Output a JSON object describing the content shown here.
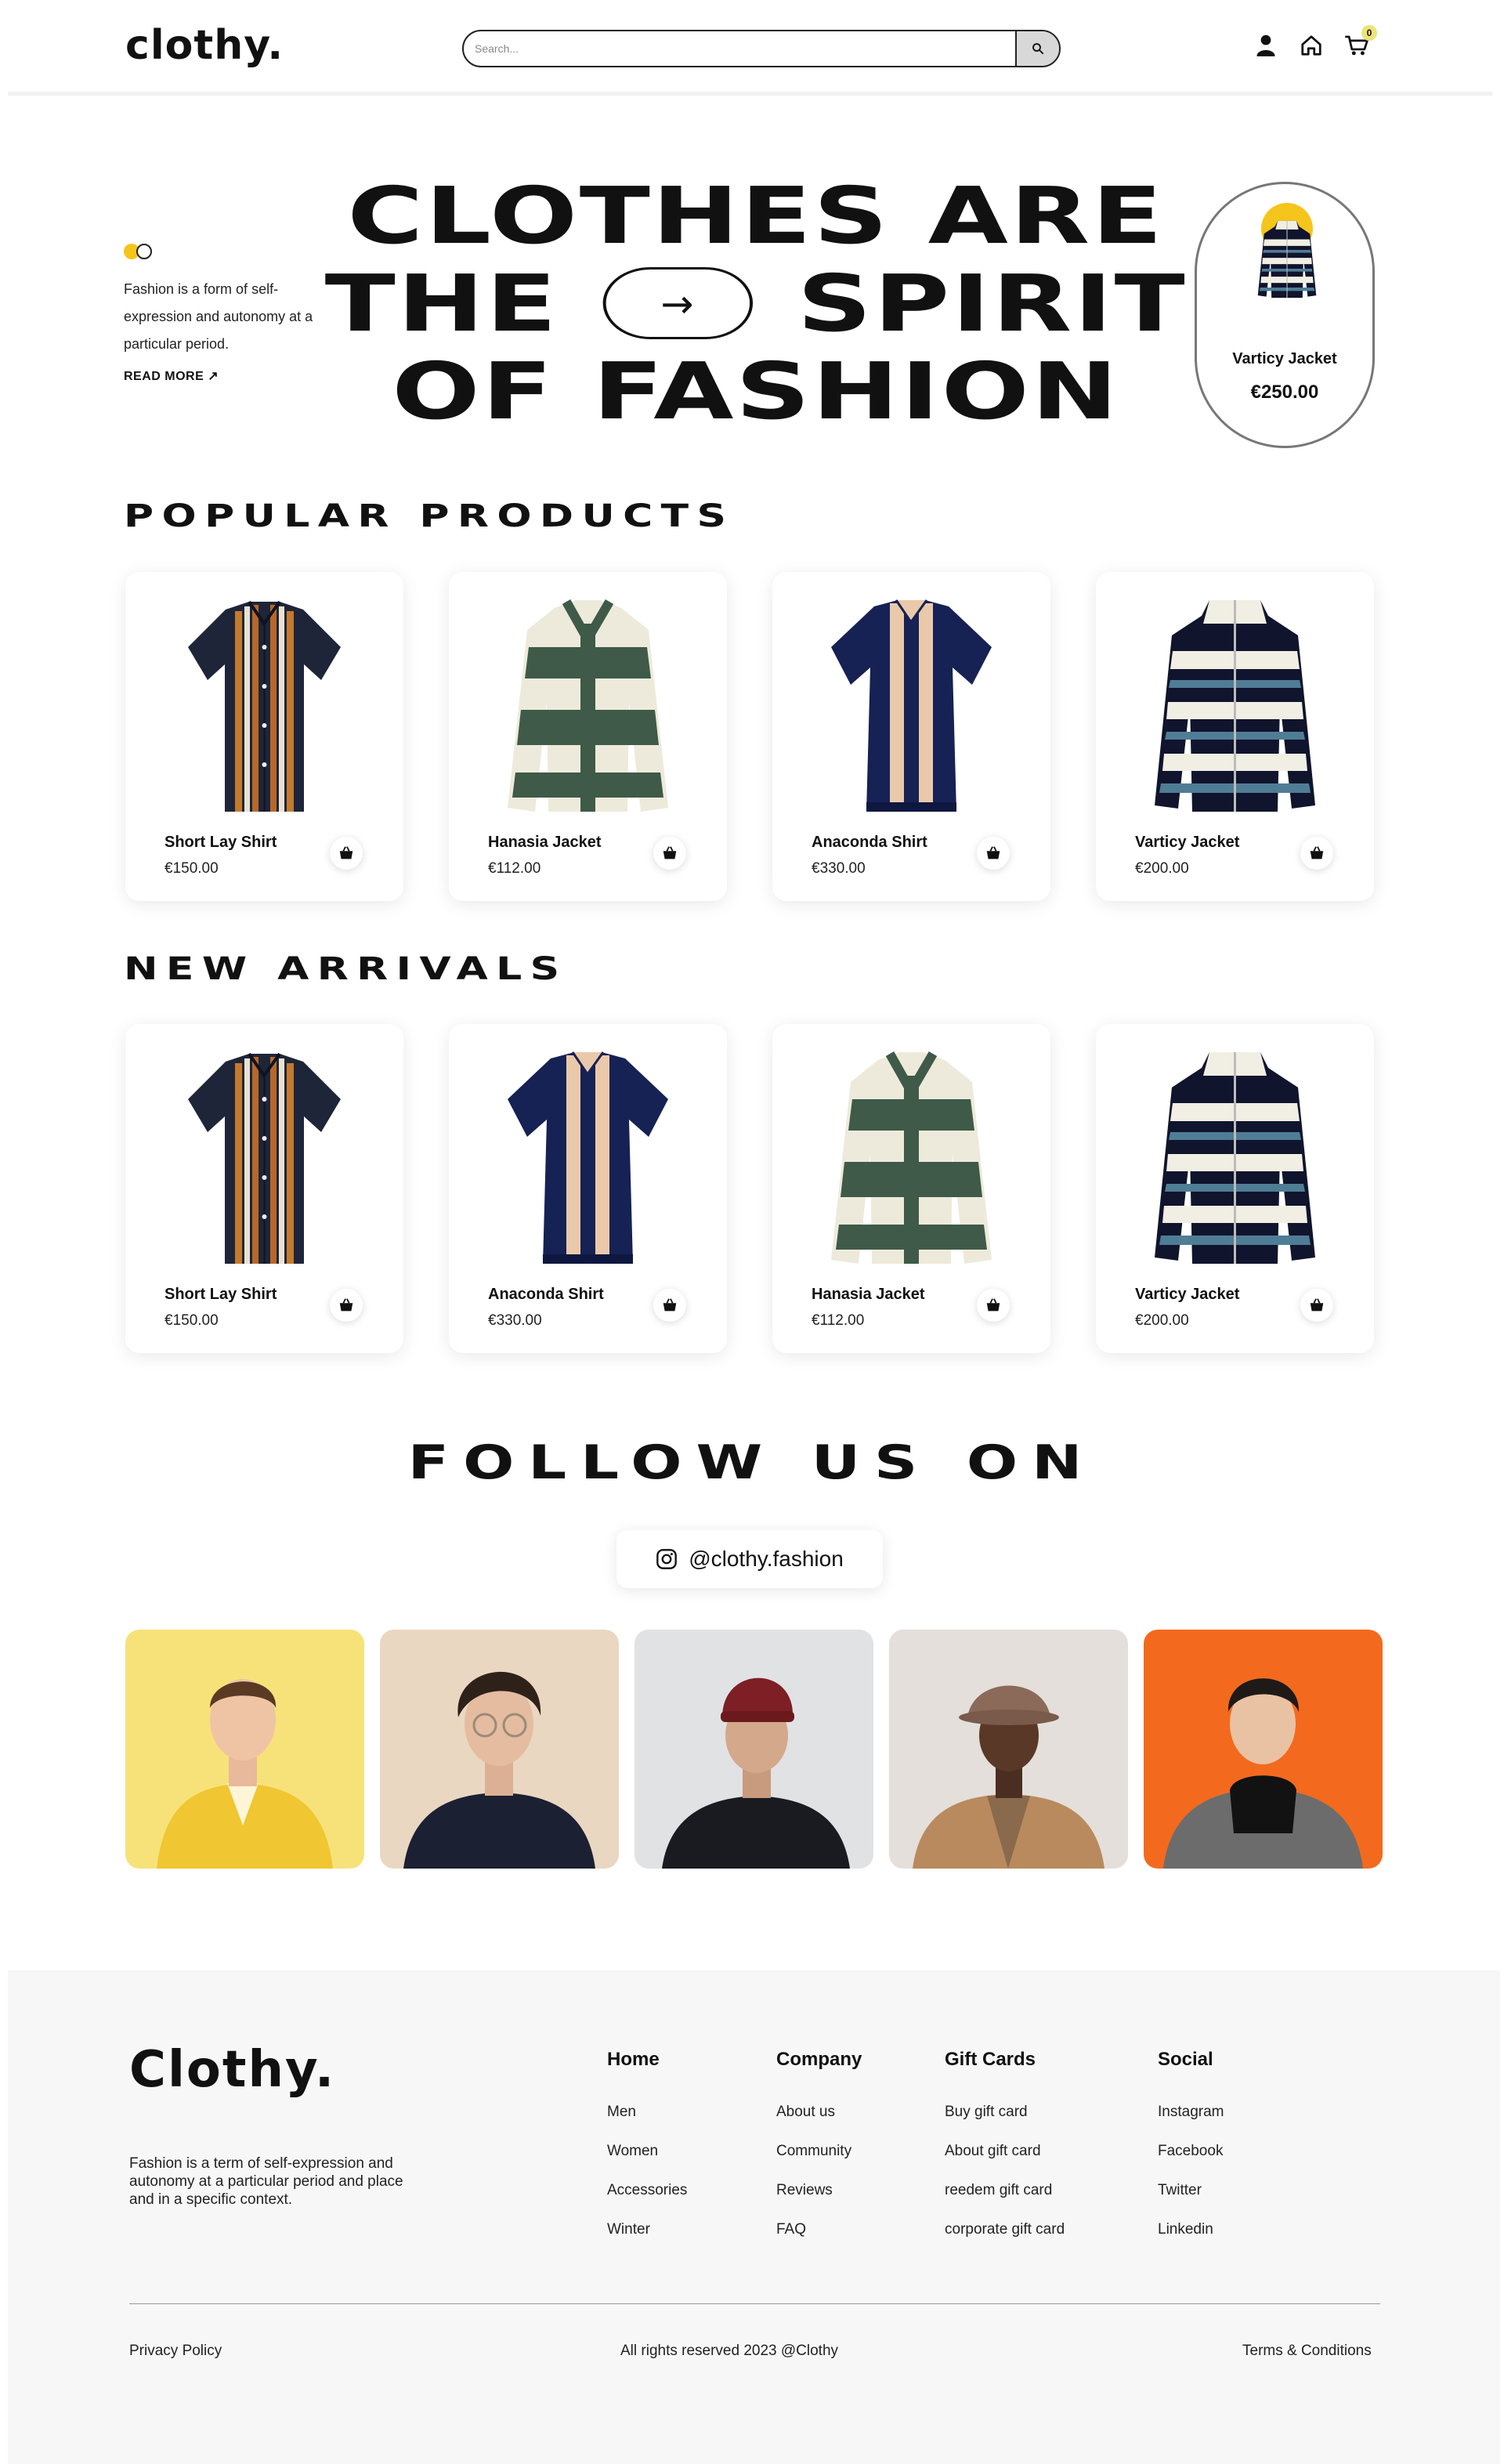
{
  "brand": {
    "logo": "clothy."
  },
  "search": {
    "placeholder": "Search..."
  },
  "header": {
    "cart_count": "0"
  },
  "hero": {
    "text": "Fashion is a form of self-expression and autonomy at a particular period.",
    "read_more": "READ MORE ↗",
    "headline": {
      "line1": "CLOTHES ARE",
      "line2_a": "THE",
      "line2_arrow": "→",
      "line2_b": "SPIRIT",
      "line3": "OF FASHION"
    },
    "featured": {
      "name": "Varticy Jacket",
      "price": "€250.00"
    }
  },
  "popular": {
    "title": "POPULAR PRODUCTS",
    "products": [
      {
        "name": "Short Lay Shirt",
        "price": "€150.00"
      },
      {
        "name": "Hanasia Jacket",
        "price": "€112.00"
      },
      {
        "name": "Anaconda Shirt",
        "price": "€330.00"
      },
      {
        "name": "Varticy Jacket",
        "price": "€200.00"
      }
    ]
  },
  "arrivals": {
    "title": "NEW ARRIVALS",
    "products": [
      {
        "name": "Short Lay Shirt",
        "price": "€150.00"
      },
      {
        "name": "Anaconda Shirt",
        "price": "€330.00"
      },
      {
        "name": "Hanasia Jacket",
        "price": "€112.00"
      },
      {
        "name": "Varticy Jacket",
        "price": "€200.00"
      }
    ]
  },
  "follow": {
    "title": "FOLLOW US ON",
    "handle": "@clothy.fashion"
  },
  "footer": {
    "logo": "Clothy.",
    "text": "Fashion is a term of self-expression and autonomy at a particular period and place and in a specific context.",
    "columns": [
      {
        "title": "Home",
        "links": [
          "Men",
          "Women",
          "Accessories",
          "Winter"
        ]
      },
      {
        "title": "Company",
        "links": [
          "About us",
          "Community",
          "Reviews",
          "FAQ"
        ]
      },
      {
        "title": "Gift Cards",
        "links": [
          "Buy gift card",
          "About gift card",
          "reedem gift card",
          "corporate gift card"
        ]
      },
      {
        "title": "Social",
        "links": [
          "Instagram",
          "Facebook",
          "Twitter",
          "Linkedin"
        ]
      }
    ],
    "privacy": "Privacy Policy",
    "copyright": "All rights reserved 2023 @Clothy",
    "terms": "Terms & Conditions"
  },
  "colors": {
    "accent": "#f5c51b",
    "badge": "#ece37a",
    "footer_bg": "#f7f7f7"
  }
}
